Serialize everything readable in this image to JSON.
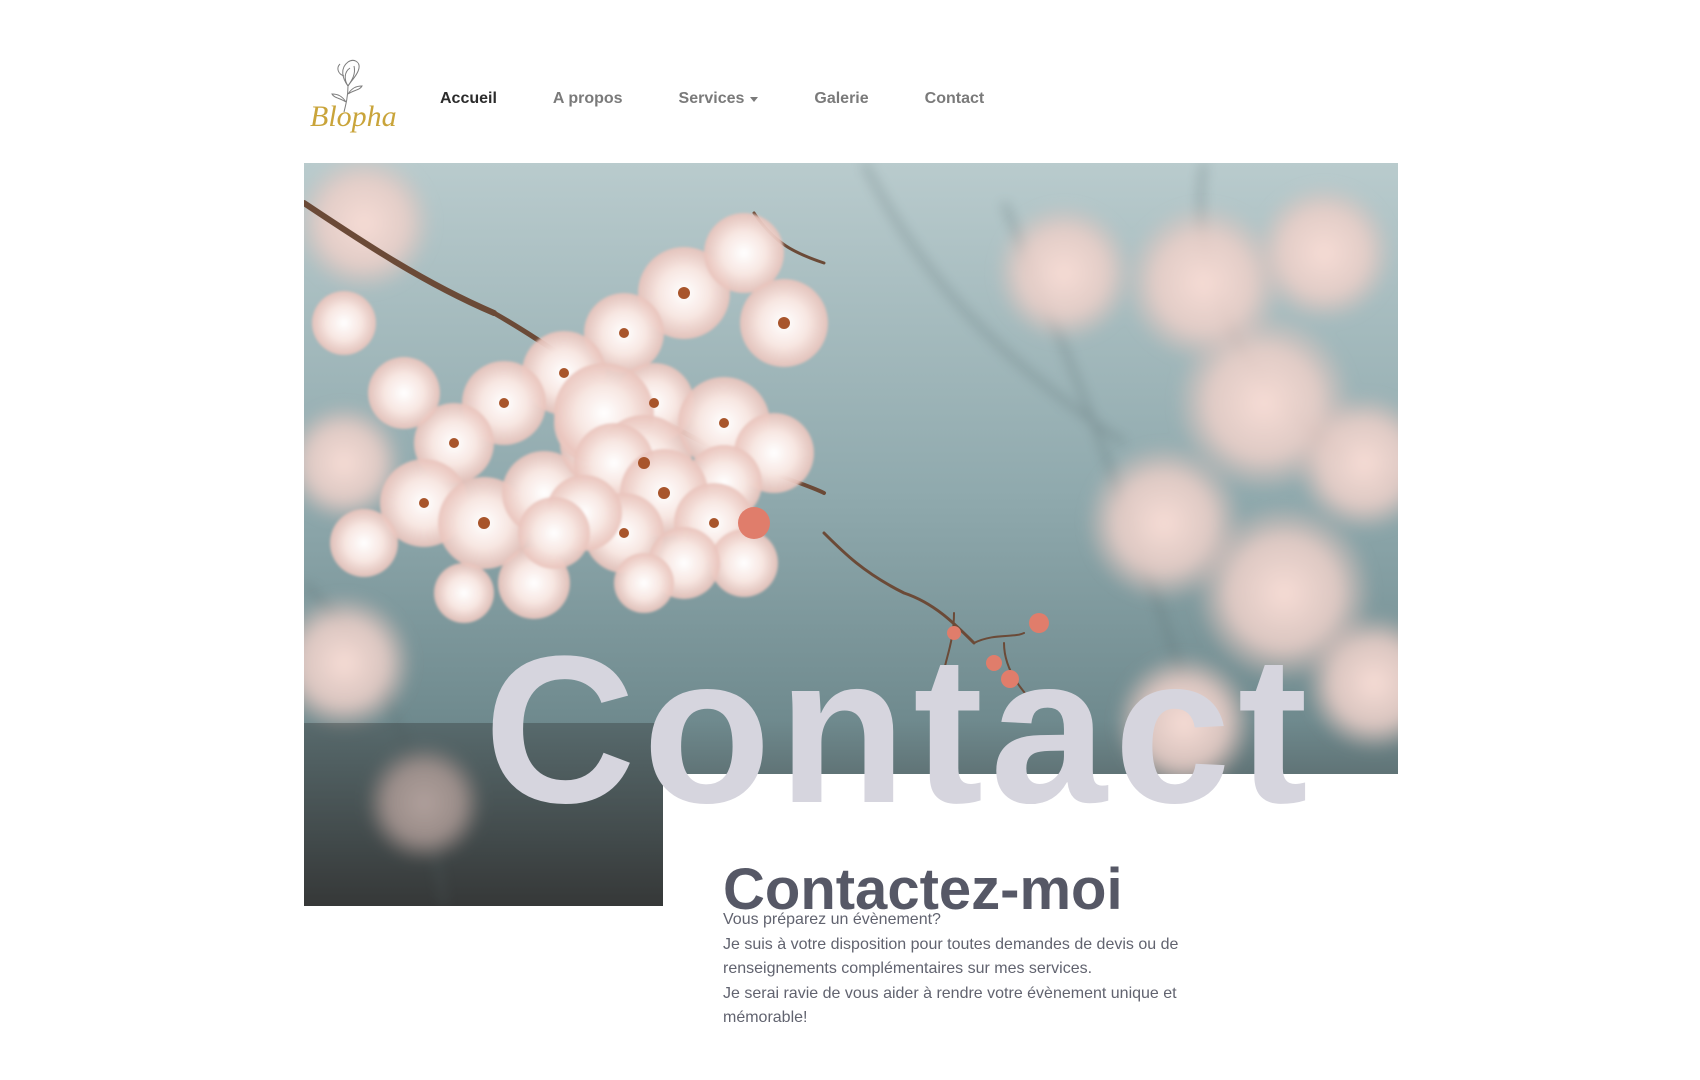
{
  "brand": {
    "logo_text": "Blopha"
  },
  "nav": {
    "items": [
      {
        "label": "Accueil",
        "active": true
      },
      {
        "label": "A propos"
      },
      {
        "label": "Services",
        "has_dropdown": true
      },
      {
        "label": "Galerie"
      },
      {
        "label": "Contact"
      }
    ]
  },
  "hero": {
    "image_description": "cherry-blossom-branch-photo",
    "watermark_title": "Contact"
  },
  "content": {
    "heading": "Contactez-moi",
    "lines": [
      "Vous préparez un évènement?",
      "Je suis à votre disposition pour toutes demandes de devis ou de renseignements complémentaires sur mes services.",
      "Je serai ravie de vous aider à rendre votre évènement unique et mémorable!"
    ]
  },
  "colors": {
    "logo_gold": "#c9a43a",
    "watermark": "#d6d5de",
    "heading": "#565866",
    "text": "#61636f"
  }
}
